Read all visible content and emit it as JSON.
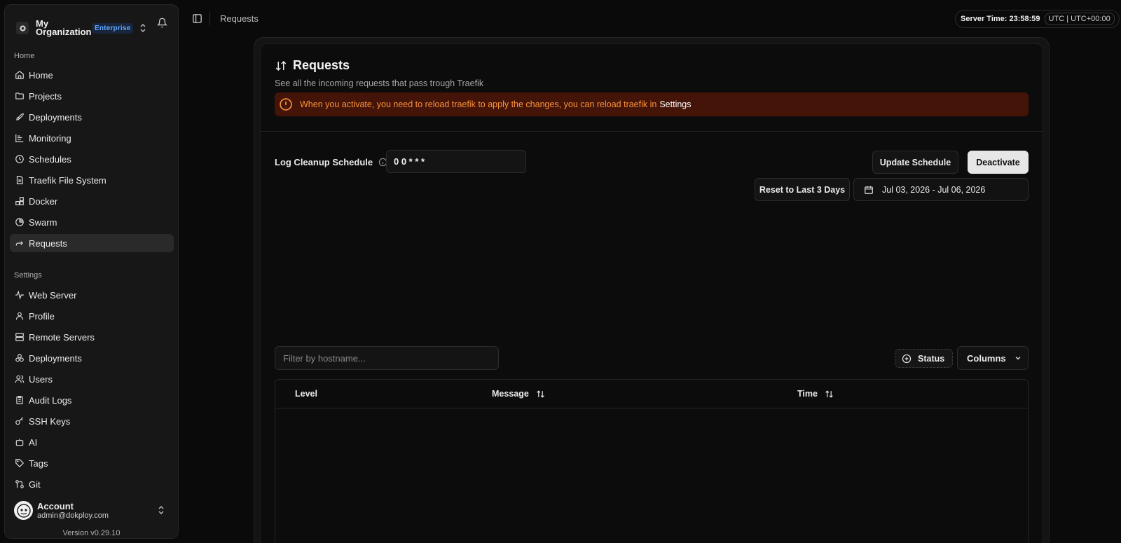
{
  "sidebar": {
    "org": {
      "name": "My Organization",
      "badge": "Enterprise"
    },
    "groups": {
      "home_label": "Home",
      "settings_label": "Settings"
    },
    "home_items": [
      {
        "label": "Home",
        "icon": "home-icon"
      },
      {
        "label": "Projects",
        "icon": "folder-icon"
      },
      {
        "label": "Deployments",
        "icon": "rocket-icon"
      },
      {
        "label": "Monitoring",
        "icon": "chart-icon"
      },
      {
        "label": "Schedules",
        "icon": "clock-icon"
      },
      {
        "label": "Traefik File System",
        "icon": "file-icon"
      },
      {
        "label": "Docker",
        "icon": "blocks-icon"
      },
      {
        "label": "Swarm",
        "icon": "pie-icon"
      },
      {
        "label": "Requests",
        "icon": "forward-icon"
      }
    ],
    "settings_items": [
      {
        "label": "Web Server",
        "icon": "activity-icon"
      },
      {
        "label": "Profile",
        "icon": "user-icon"
      },
      {
        "label": "Remote Servers",
        "icon": "server-icon"
      },
      {
        "label": "Deployments",
        "icon": "boxes-icon"
      },
      {
        "label": "Users",
        "icon": "users-icon"
      },
      {
        "label": "Audit Logs",
        "icon": "clipboard-icon"
      },
      {
        "label": "SSH Keys",
        "icon": "key-icon"
      },
      {
        "label": "AI",
        "icon": "bot-icon"
      },
      {
        "label": "Tags",
        "icon": "tag-icon"
      },
      {
        "label": "Git",
        "icon": "git-icon"
      }
    ],
    "active_item": "Requests",
    "account": {
      "name": "Account",
      "email": "admin@dokploy.com"
    },
    "version": "Version v0.29.10"
  },
  "topbar": {
    "breadcrumb": "Requests",
    "server_time_label": "Server Time: 23:58:59",
    "timezone": "UTC | UTC+00:00"
  },
  "page": {
    "title": "Requests",
    "subtitle": "See all the incoming requests that pass trough Traefik",
    "alert": {
      "message": "When you activate, you need to reload traefik to apply the changes, you can reload traefik in",
      "link": "Settings"
    },
    "log_cleanup": {
      "label": "Log Cleanup Schedule",
      "value": "0 0 * * *"
    },
    "buttons": {
      "update_schedule": "Update Schedule",
      "deactivate": "Deactivate",
      "reset": "Reset to Last 3 Days",
      "date_range": "Jul 03, 2026 - Jul 06, 2026"
    },
    "filter": {
      "placeholder": "Filter by hostname...",
      "value": ""
    },
    "status_button": "Status",
    "columns_button": "Columns",
    "table": {
      "headers": [
        "Level",
        "Message",
        "Time"
      ],
      "rows": []
    }
  },
  "colors": {
    "accent_alert_bg": "#431407",
    "accent_alert_text": "#fb923c",
    "badge_text": "#60a5fa"
  }
}
